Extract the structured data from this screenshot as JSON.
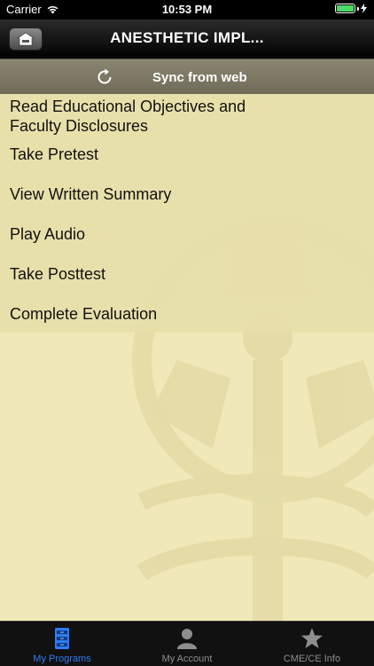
{
  "status_bar": {
    "carrier": "Carrier",
    "time": "10:53 PM",
    "battery_color": "#4cd964"
  },
  "nav": {
    "title": "ANESTHETIC IMPL...",
    "home_icon": "home-icon"
  },
  "sync": {
    "label": "Sync from web",
    "icon": "refresh-icon"
  },
  "menu": {
    "items": [
      {
        "label_line1": "Read Educational Objectives and",
        "label_line2": "Faculty Disclosures"
      },
      {
        "label": "Take Pretest"
      },
      {
        "label": "View Written Summary"
      },
      {
        "label": "Play Audio"
      },
      {
        "label": "Take Posttest"
      },
      {
        "label": "Complete Evaluation"
      }
    ]
  },
  "tabs": [
    {
      "label": "My Programs",
      "icon": "cabinet-icon",
      "active": true
    },
    {
      "label": "My Account",
      "icon": "person-icon",
      "active": false
    },
    {
      "label": "CME/CE Info",
      "icon": "star-icon",
      "active": false
    }
  ],
  "colors": {
    "accent": "#2d7cf6",
    "background": "#f0e8b8",
    "menu_background": "#e7dea8"
  }
}
